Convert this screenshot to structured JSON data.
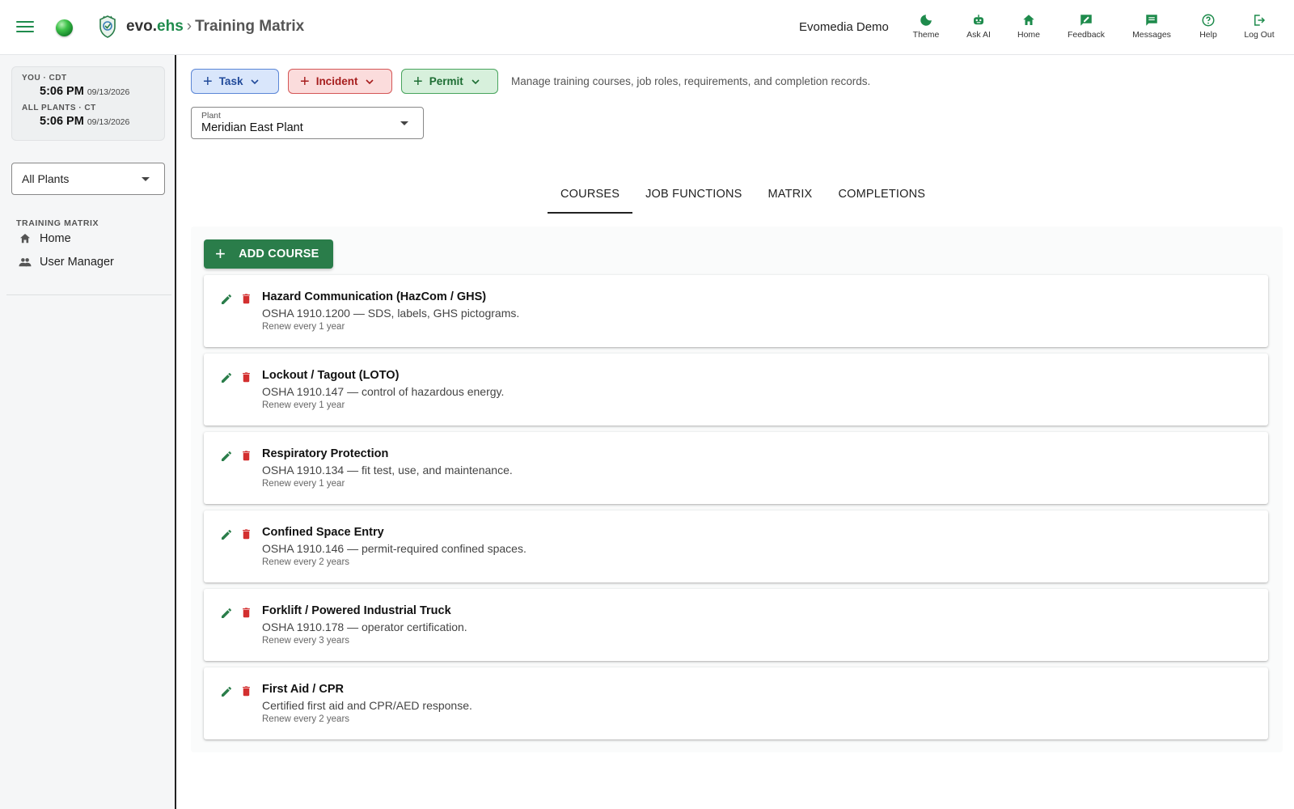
{
  "header": {
    "brand_prefix": "evo.",
    "brand_suffix": "ehs",
    "separator": "›",
    "page_title": "Training Matrix",
    "org_name": "Evomedia Demo",
    "nav": [
      {
        "label": "Theme",
        "icon": "moon-icon"
      },
      {
        "label": "Ask AI",
        "icon": "robot-icon"
      },
      {
        "label": "Home",
        "icon": "home-icon"
      },
      {
        "label": "Feedback",
        "icon": "feedback-icon"
      },
      {
        "label": "Messages",
        "icon": "message-icon"
      },
      {
        "label": "Help",
        "icon": "help-icon"
      },
      {
        "label": "Log Out",
        "icon": "logout-icon"
      }
    ]
  },
  "sidebar": {
    "clock": {
      "you_label": "YOU · CDT",
      "you_time": "5:06 PM",
      "you_date": "09/13/2026",
      "plants_label": "ALL PLANTS · CT",
      "plants_time": "5:06 PM",
      "plants_date": "09/13/2026"
    },
    "plant_filter": "All Plants",
    "section_label": "TRAINING MATRIX",
    "items": [
      {
        "label": "Home",
        "icon": "home-icon"
      },
      {
        "label": "User Manager",
        "icon": "people-icon"
      }
    ]
  },
  "actions": {
    "task": "Task",
    "incident": "Incident",
    "permit": "Permit",
    "subtitle": "Manage training courses, job roles, requirements, and completion records."
  },
  "plant_field": {
    "label": "Plant",
    "value": "Meridian East Plant"
  },
  "tabs": [
    {
      "label": "COURSES",
      "active": true
    },
    {
      "label": "JOB FUNCTIONS",
      "active": false
    },
    {
      "label": "MATRIX",
      "active": false
    },
    {
      "label": "COMPLETIONS",
      "active": false
    }
  ],
  "add_course_label": "ADD COURSE",
  "courses": [
    {
      "title": "Hazard Communication (HazCom / GHS)",
      "desc": "OSHA 1910.1200 — SDS, labels, GHS pictograms.",
      "renew": "Renew every 1 year"
    },
    {
      "title": "Lockout / Tagout (LOTO)",
      "desc": "OSHA 1910.147 — control of hazardous energy.",
      "renew": "Renew every 1 year"
    },
    {
      "title": "Respiratory Protection",
      "desc": "OSHA 1910.134 — fit test, use, and maintenance.",
      "renew": "Renew every 1 year"
    },
    {
      "title": "Confined Space Entry",
      "desc": "OSHA 1910.146 — permit-required confined spaces.",
      "renew": "Renew every 2 years"
    },
    {
      "title": "Forklift / Powered Industrial Truck",
      "desc": "OSHA 1910.178 — operator certification.",
      "renew": "Renew every 3 years"
    },
    {
      "title": "First Aid / CPR",
      "desc": "Certified first aid and CPR/AED response.",
      "renew": "Renew every 2 years"
    }
  ],
  "colors": {
    "brand_green": "#1e8b4c",
    "button_green": "#2a7d4a",
    "delete_red": "#d32f2f"
  }
}
